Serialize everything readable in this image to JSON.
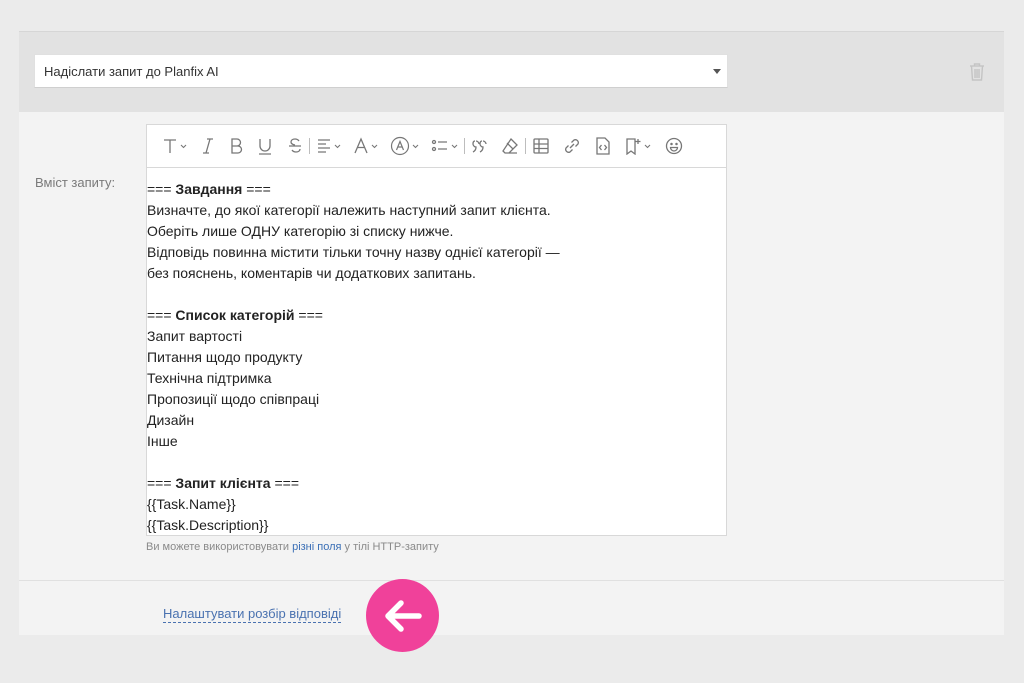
{
  "action": {
    "select_value": "Надіслати запит до Planfix AI"
  },
  "field": {
    "label": "Вміст запиту:"
  },
  "toolbar": {
    "icons": [
      "text-style",
      "italic",
      "bold",
      "underline",
      "strikethrough",
      "align",
      "font",
      "color",
      "list",
      "quote",
      "clear-format",
      "table",
      "link",
      "code",
      "bookmark",
      "emoji"
    ]
  },
  "editor": {
    "lines": [
      {
        "pre": "=== ",
        "bold": "Завдання",
        "post": " ==="
      },
      {
        "text": "Визначте, до якої категорії належить наступний запит клієнта."
      },
      {
        "text": "Оберіть лише ОДНУ категорію зі списку нижче."
      },
      {
        "text": "Відповідь повинна містити тільки точну назву однієї категорії —"
      },
      {
        "text": "без пояснень, коментарів чи додаткових запитань."
      },
      {
        "text": ""
      },
      {
        "pre": "=== ",
        "bold": "Список категорій",
        "post": " ==="
      },
      {
        "text": "Запит вартості"
      },
      {
        "text": "Питання щодо продукту"
      },
      {
        "text": "Технічна підтримка"
      },
      {
        "text": "Пропозиції щодо співпраці"
      },
      {
        "text": "Дизайн"
      },
      {
        "text": "Інше"
      },
      {
        "text": ""
      },
      {
        "pre": "=== ",
        "bold": "Запит клієнта",
        "post": " ==="
      },
      {
        "text": "{{Task.Name}}"
      },
      {
        "text": "{{Task.Description}}"
      }
    ]
  },
  "hint": {
    "prefix": "Ви можете використовувати ",
    "link": "різні поля",
    "suffix": " у тілі HTTP-запиту"
  },
  "config_link": "Налаштувати розбір відповіді",
  "colors": {
    "accent_pink": "#f0419a",
    "link_blue": "#4a72b0"
  }
}
